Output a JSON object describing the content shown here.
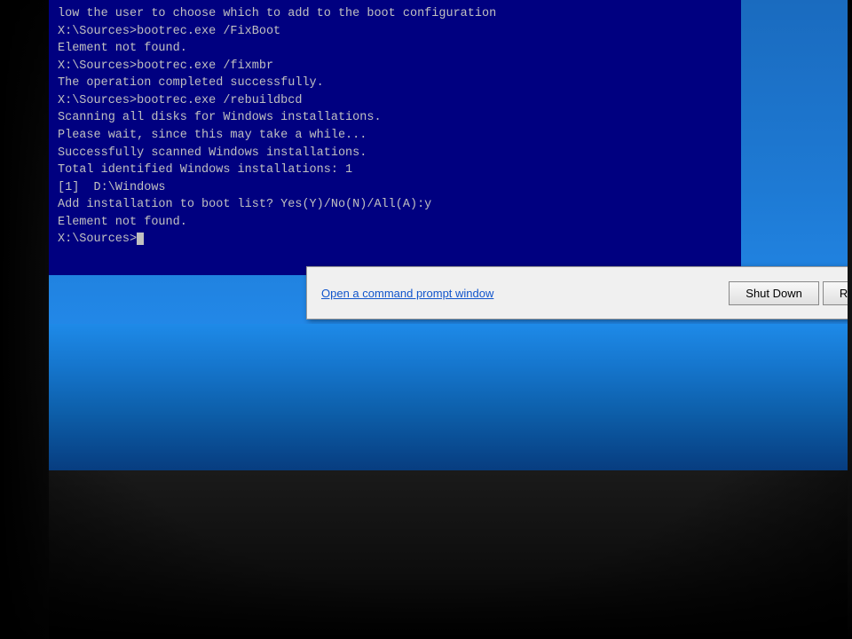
{
  "screen": {
    "top_partial_text": "low the user to choose which to add to the boot configuration",
    "cmd_lines": [
      "",
      "X:\\Sources>bootrec.exe /FixBoot",
      "Element not found.",
      "",
      "X:\\Sources>bootrec.exe /fixmbr",
      "The operation completed successfully.",
      "",
      "X:\\Sources>bootrec.exe /rebuildbcd",
      "Scanning all disks for Windows installations.",
      "",
      "Please wait, since this may take a while...",
      "",
      "Successfully scanned Windows installations.",
      "Total identified Windows installations: 1",
      "[1]  D:\\Windows",
      "Add installation to boot list? Yes(Y)/No(N)/All(A):y",
      "Element not found.",
      ""
    ],
    "prompt_line": "X:\\Sources>",
    "dialog": {
      "link_text": "Open a command prompt window",
      "shutdown_btn": "Shut Down",
      "restart_btn": "Res"
    }
  }
}
